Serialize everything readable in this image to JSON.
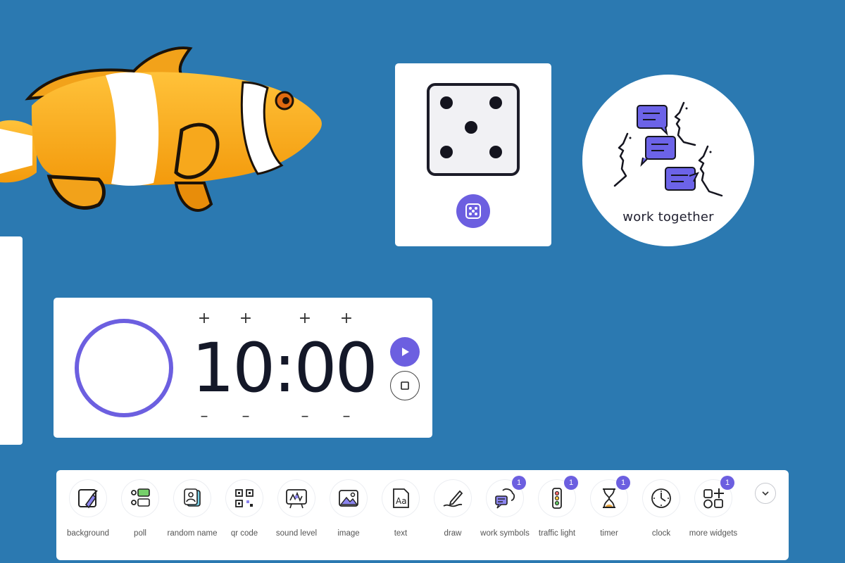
{
  "work_together": {
    "label": "work together"
  },
  "timer": {
    "display": "10:00"
  },
  "toolbar": {
    "items": [
      {
        "label": "background",
        "icon": "background-icon"
      },
      {
        "label": "poll",
        "icon": "poll-icon"
      },
      {
        "label": "random name",
        "icon": "random-name-icon"
      },
      {
        "label": "qr code",
        "icon": "qr-code-icon"
      },
      {
        "label": "sound level",
        "icon": "sound-level-icon"
      },
      {
        "label": "image",
        "icon": "image-icon"
      },
      {
        "label": "text",
        "icon": "text-icon"
      },
      {
        "label": "draw",
        "icon": "draw-icon"
      },
      {
        "label": "work symbols",
        "icon": "work-symbols-icon",
        "badge": "1"
      },
      {
        "label": "traffic light",
        "icon": "traffic-light-icon",
        "badge": "1"
      },
      {
        "label": "timer",
        "icon": "hourglass-icon",
        "badge": "1"
      },
      {
        "label": "clock",
        "icon": "clock-icon"
      },
      {
        "label": "more widgets",
        "icon": "more-widgets-icon",
        "badge": "1"
      }
    ]
  },
  "colors": {
    "background": "#2b79b1",
    "accent": "#6c5fe0"
  }
}
